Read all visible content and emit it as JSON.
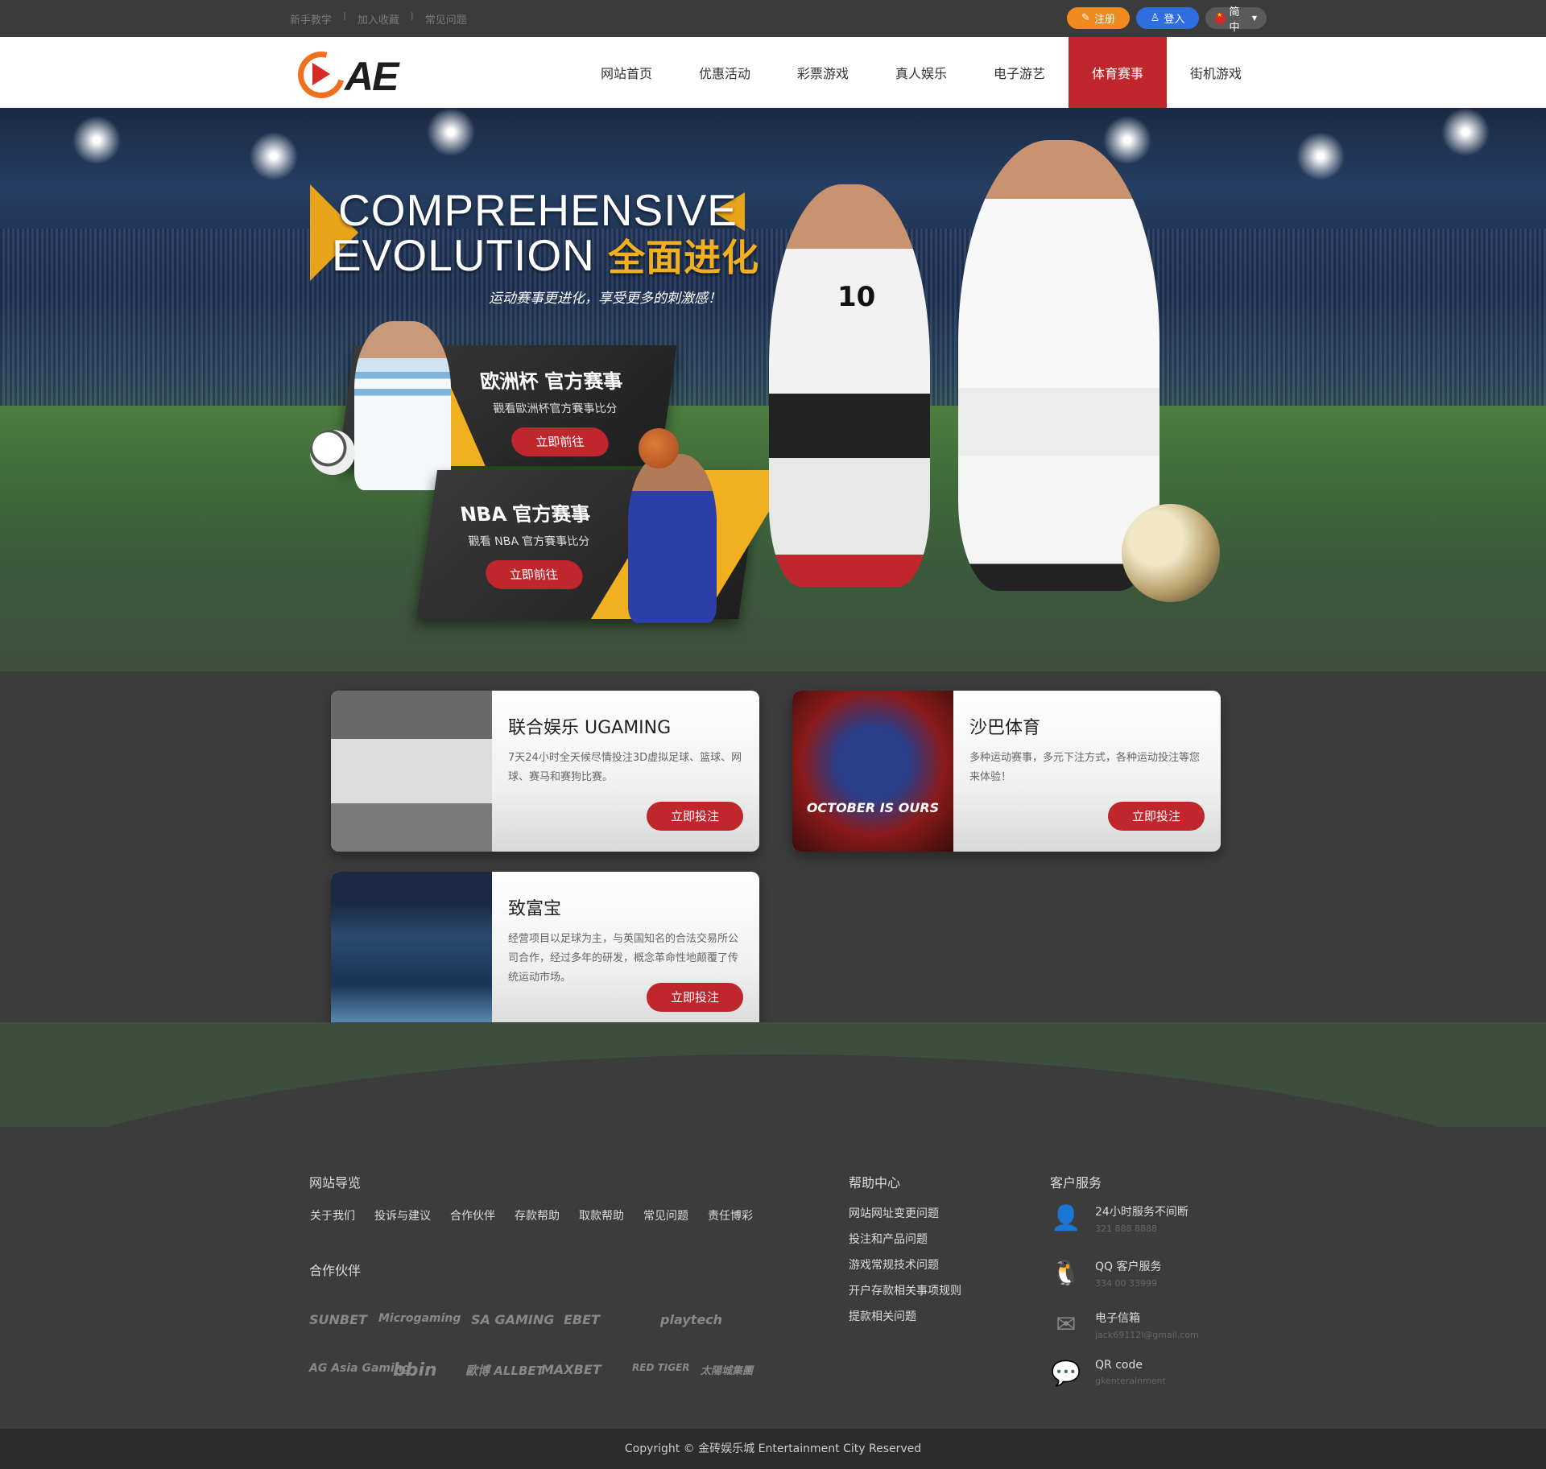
{
  "topbar": {
    "links": [
      "新手教学",
      "加入收藏",
      "常见问题"
    ],
    "separator": "I",
    "register": "注册",
    "login": "登入",
    "language": "简中"
  },
  "header": {
    "logo_text": "AE",
    "nav": [
      "网站首页",
      "优惠活动",
      "彩票游戏",
      "真人娱乐",
      "电子游艺",
      "体育赛事",
      "街机游戏"
    ],
    "active_index": 5
  },
  "hero": {
    "headline_line1": "COMPREHENSIVE",
    "headline_line2": "EVOLUTION",
    "headline_cn": "全面进化",
    "subtitle": "运动赛事更进化，享受更多的刺激感！",
    "promos": [
      {
        "title": "欧洲杯 官方赛事",
        "desc": "觀看歐洲杯官方賽事比分",
        "button": "立即前往"
      },
      {
        "title": "NBA 官方赛事",
        "desc": "觀看 NBA 官方賽事比分",
        "button": "立即前往"
      }
    ],
    "jersey_number": "10"
  },
  "cards": [
    {
      "title": "联合娱乐 UGAMING",
      "desc": "7天24小时全天候尽情投注3D虚拟足球、篮球、网球、赛马和赛狗比赛。",
      "button": "立即投注",
      "image_text": ""
    },
    {
      "title": "沙巴体育",
      "desc": "多种运动赛事，多元下注方式，各种运动投注等您来体验！",
      "button": "立即投注",
      "image_text": "OCTOBER IS OURS"
    },
    {
      "title": "致富宝",
      "desc": "经营项目以足球为主，与英国知名的合法交易所公司合作，经过多年的研发，概念革命性地颠覆了传统运动市场。",
      "button": "立即投注",
      "image_text": ""
    }
  ],
  "footer": {
    "nav_title": "网站导览",
    "nav_links": [
      "关于我们",
      "投诉与建议",
      "合作伙伴",
      "存款帮助",
      "取款帮助",
      "常见问题",
      "责任博彩"
    ],
    "partners_title": "合作伙伴",
    "partners_row1": [
      "SUNBET",
      "Microgaming",
      "SA GAMING",
      "EBET",
      "playtech"
    ],
    "partners_row2": [
      "AG Asia Gaming",
      "bbin",
      "歐博 ALLBET",
      "MAXBET",
      "RED TIGER",
      "太陽城集團"
    ],
    "help_title": "帮助中心",
    "help_links": [
      "网站网址变更问题",
      "投注和产品问题",
      "游戏常规技术问题",
      "开户存款相关事项规则",
      "提款相关问题"
    ],
    "service_title": "客户服务",
    "services": [
      {
        "icon": "person-icon",
        "title": "24小时服务不间断",
        "detail": "321 888 8888"
      },
      {
        "icon": "qq-icon",
        "title": "QQ 客户服务",
        "detail": "334 00 33999"
      },
      {
        "icon": "mail-icon",
        "title": "电子信箱",
        "detail": "jack69112l@gmail.com"
      },
      {
        "icon": "wechat-icon",
        "title": "QR code",
        "detail": "gkenteralnment"
      }
    ],
    "copyright": "Copyright © 金砖娱乐城 Entertainment City Reserved"
  },
  "colors": {
    "accent_red": "#c0272d",
    "orange": "#f08a1c",
    "blue": "#2f6ee0",
    "gold": "#f0b020"
  }
}
